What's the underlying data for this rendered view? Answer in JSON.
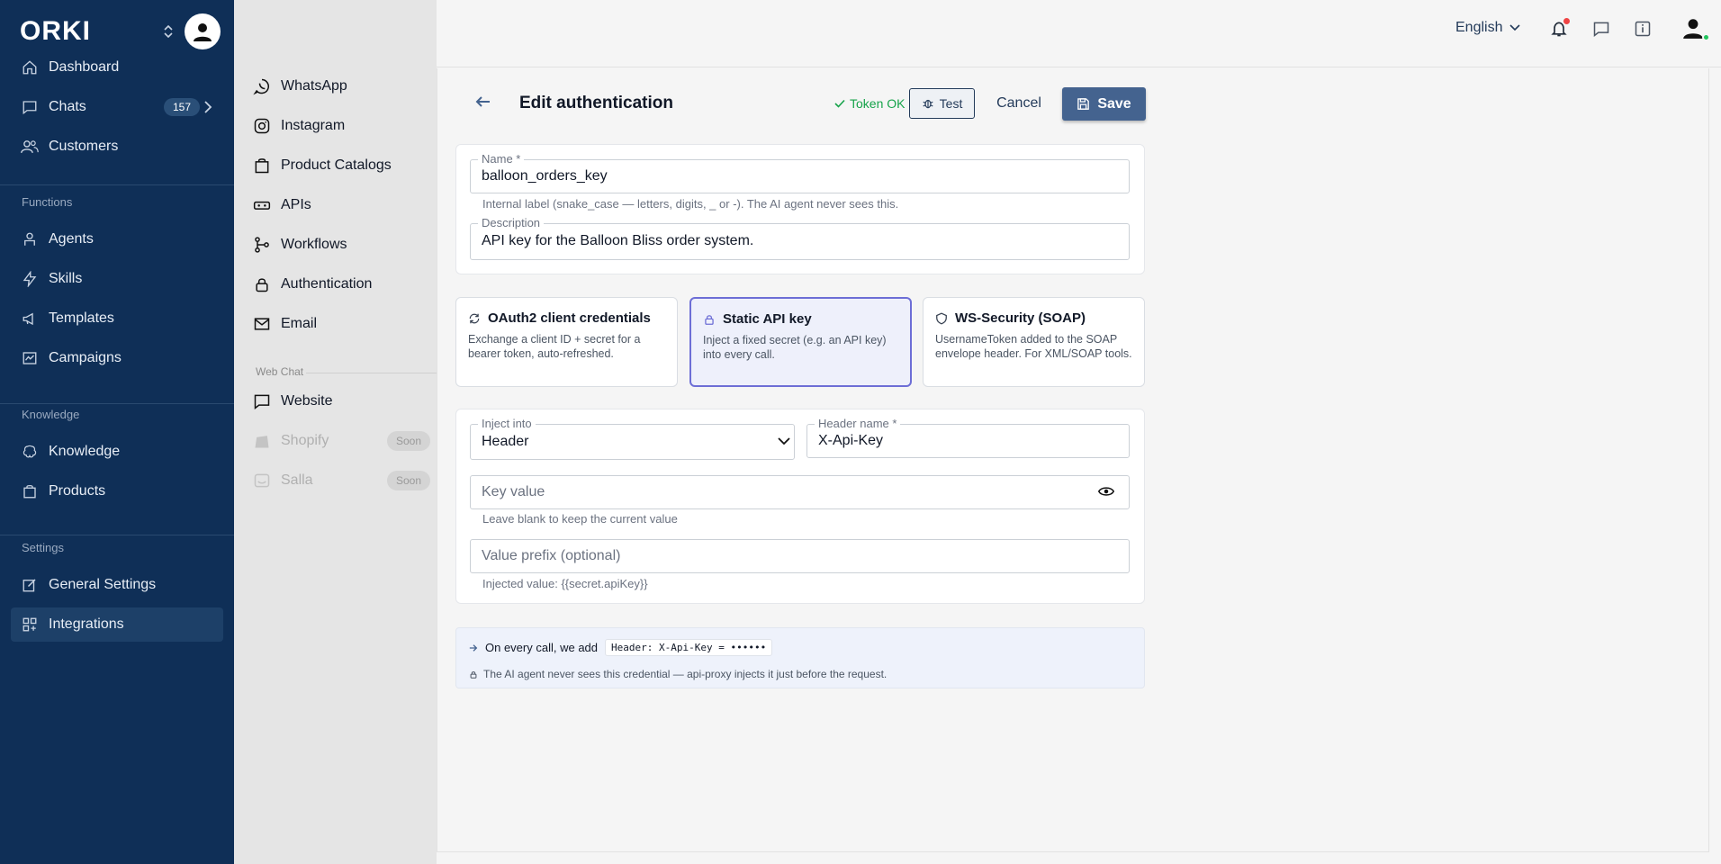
{
  "brand": {
    "logo_text": "ORKI"
  },
  "sidebar": {
    "items": [
      {
        "label": "Dashboard"
      },
      {
        "label": "Chats",
        "badge": "157"
      },
      {
        "label": "Customers"
      },
      {
        "label": "Agents"
      },
      {
        "label": "Skills"
      },
      {
        "label": "Templates"
      },
      {
        "label": "Campaigns"
      },
      {
        "label": "Knowledge"
      },
      {
        "label": "Products"
      },
      {
        "label": "General Settings"
      },
      {
        "label": "Integrations",
        "active": true
      }
    ],
    "sections": {
      "functions": "Functions",
      "knowledge": "Knowledge",
      "settings": "Settings"
    }
  },
  "subnav": {
    "items": [
      {
        "label": "WhatsApp"
      },
      {
        "label": "Instagram"
      },
      {
        "label": "Product Catalogs"
      },
      {
        "label": "APIs"
      },
      {
        "label": "Workflows"
      },
      {
        "label": "Authentication"
      },
      {
        "label": "Email"
      }
    ],
    "webchat_section": "Web Chat",
    "webchat_items": [
      {
        "label": "Website"
      },
      {
        "label": "Shopify",
        "badge": "Soon",
        "disabled": true
      },
      {
        "label": "Salla",
        "badge": "Soon",
        "disabled": true
      }
    ]
  },
  "topbar": {
    "language": "English"
  },
  "header": {
    "title": "Edit authentication",
    "token_status": "Token OK",
    "test_label": "Test",
    "cancel_label": "Cancel",
    "save_label": "Save"
  },
  "form": {
    "name_label": "Name *",
    "name_value": "balloon_orders_key",
    "name_help": "Internal label (snake_case — letters, digits, _ or -). The AI agent never sees this.",
    "description_label": "Description",
    "description_value": "API key for the Balloon Bliss order system."
  },
  "auth_types": [
    {
      "title": "OAuth2 client credentials",
      "desc": "Exchange a client ID + secret for a bearer token, auto-refreshed."
    },
    {
      "title": "Static API key",
      "desc": "Inject a fixed secret (e.g. an API key) into every call.",
      "selected": true
    },
    {
      "title": "WS-Security (SOAP)",
      "desc": "UsernameToken added to the SOAP envelope header. For XML/SOAP tools."
    }
  ],
  "config": {
    "inject_label": "Inject into",
    "inject_value": "Header",
    "header_name_label": "Header name *",
    "header_name_value": "X-Api-Key",
    "key_placeholder": "Key value",
    "key_help": "Leave blank to keep the current value",
    "prefix_placeholder": "Value prefix (optional)",
    "injected_help": "Injected value: {{secret.apiKey}}"
  },
  "info": {
    "line1": "On every call, we add",
    "code": "Header: X-Api-Key = ••••••",
    "line2": "The AI agent never sees this credential — api-proxy injects it just before the request."
  },
  "colors": {
    "sidebar_bg": "#0f2f57",
    "primary": "#44638f",
    "success": "#16a34a",
    "selected_border": "#6d6ed6"
  }
}
